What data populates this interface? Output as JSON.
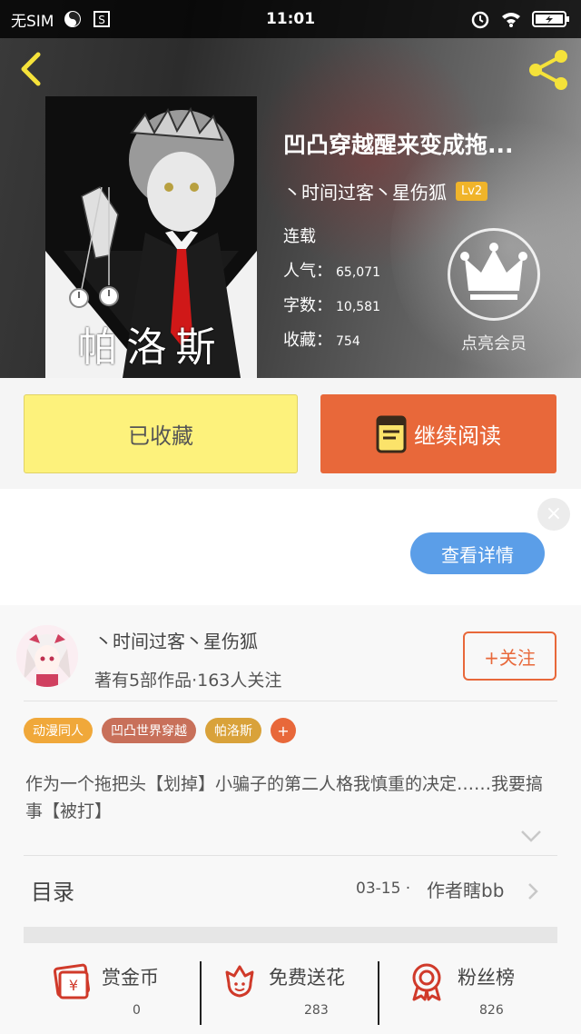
{
  "status_bar": {
    "carrier": "无SIM",
    "time": "11:01"
  },
  "book": {
    "title": "凹凸穿越醒来变成拖...",
    "cover_text": "帕洛斯",
    "author": "丶时间过客丶星伤狐",
    "level": "Lv2",
    "status": "连载",
    "popularity_label": "人气：",
    "popularity": "65,071",
    "words_label": "字数：",
    "words": "10,581",
    "favorites_label": "收藏：",
    "favorites": "754",
    "vip_label": "点亮会员"
  },
  "actions": {
    "collected_label": "已收藏",
    "continue_label": "继续阅读"
  },
  "ad": {
    "close": "×",
    "details_label": "查看详情"
  },
  "author_info": {
    "name": "丶时间过客丶星伤狐",
    "meta": "著有5部作品·163人关注",
    "follow_label": "+关注"
  },
  "tags": [
    {
      "label": "动漫同人",
      "color": "#f0a83a"
    },
    {
      "label": "凹凸世界穿越",
      "color": "#c8705a"
    },
    {
      "label": "帕洛斯",
      "color": "#d9a23a"
    }
  ],
  "tag_add": "+",
  "description": "作为一个拖把头【划掉】小骗子的第二人格我慎重的决定……我要搞事【被打】",
  "toc": {
    "label": "目录",
    "date": "03-15 ·",
    "author": "作者瞎bb"
  },
  "bottom_bar": [
    {
      "label": "赏金币",
      "count": "0",
      "icon": "gold-coin-icon"
    },
    {
      "label": "免费送花",
      "count": "283",
      "icon": "flower-icon"
    },
    {
      "label": "粉丝榜",
      "count": "826",
      "icon": "medal-icon"
    }
  ],
  "colors": {
    "accent": "#e8683a",
    "collected_bg": "#fdf27c",
    "details_blue": "#5b9ee8",
    "badge_gold": "#f0b42a"
  }
}
